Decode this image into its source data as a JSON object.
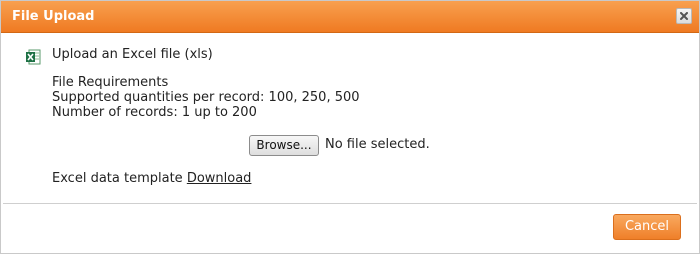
{
  "dialog": {
    "title": "File Upload",
    "close_icon": "close-icon"
  },
  "upload": {
    "icon": "excel-file-icon",
    "heading": "Upload an Excel file (xls)"
  },
  "requirements": {
    "title": "File Requirements",
    "line1": "Supported quantities per record: 100, 250, 500",
    "line2": "Number of records: 1 up to 200"
  },
  "file_input": {
    "button_label": "Browse...",
    "status": "No file selected."
  },
  "template": {
    "label": "Excel data template",
    "link_label": "Download"
  },
  "footer": {
    "cancel_label": "Cancel"
  },
  "colors": {
    "accent": "#ef7a22",
    "excel_green": "#1e7145"
  }
}
